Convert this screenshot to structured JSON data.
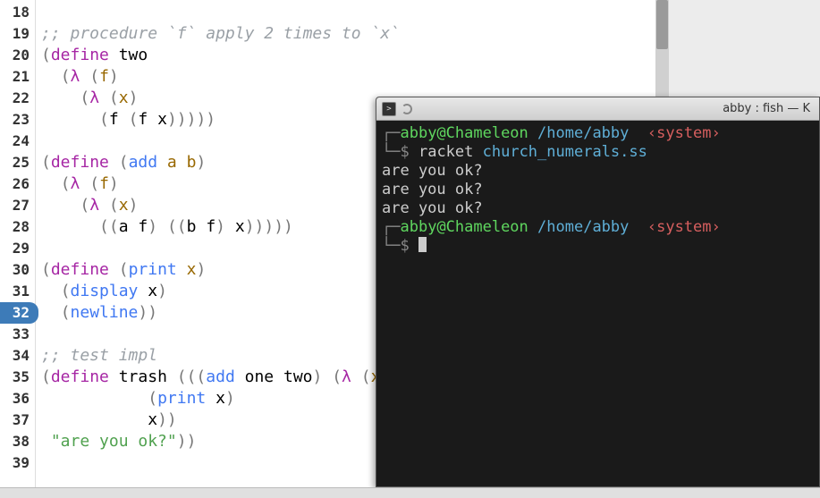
{
  "gutter_start": 18,
  "gutter_end": 39,
  "current_line": 32,
  "code": {
    "l18": "",
    "l19_comment": ";; procedure `f` apply 2 times to `x`",
    "l20_def": "define",
    "l20_name": "two",
    "l21_lam": "λ",
    "l21_p": "f",
    "l22_lam": "λ",
    "l22_p": "x",
    "l23_a": "f",
    "l23_b": "f",
    "l23_c": "x",
    "l25_def": "define",
    "l25_name": "add",
    "l25_a": "a",
    "l25_b": "b",
    "l26_lam": "λ",
    "l26_p": "f",
    "l27_lam": "λ",
    "l27_p": "x",
    "l28_a": "a",
    "l28_b": "f",
    "l28_c": "b",
    "l28_d": "f",
    "l28_e": "x",
    "l30_def": "define",
    "l30_name": "print",
    "l30_p": "x",
    "l31_call": "display",
    "l31_p": "x",
    "l32_call": "newline",
    "l34_comment": ";; test impl",
    "l35_def": "define",
    "l35_name": "trash",
    "l35_add": "add",
    "l35_one": "one",
    "l35_two": "two",
    "l35_lam": "λ",
    "l35_p": "x",
    "l36_call": "print",
    "l36_p": "x",
    "l37_a": "x",
    "l38_str": "\"are you ok?\""
  },
  "terminal": {
    "title": "abby : fish — K",
    "user": "abby@Chameleon",
    "path": "/home/abby",
    "tag": "‹system›",
    "prompt": "$",
    "cmd": "racket",
    "arg": "church_numerals.ss",
    "out1": "are you ok?",
    "out2": "are you ok?",
    "out3": "are you ok?"
  }
}
